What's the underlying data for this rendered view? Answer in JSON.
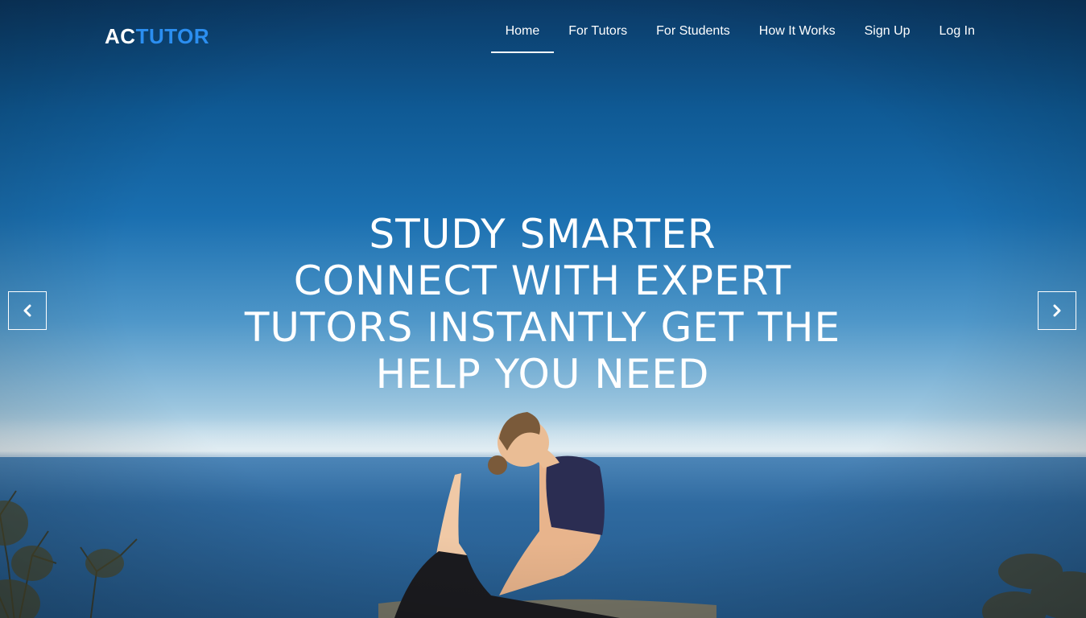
{
  "brand": {
    "logo_part1": "AC",
    "logo_part2": "TUTOR",
    "accent_color": "#2b8ef0"
  },
  "nav": {
    "items": [
      {
        "label": "Home",
        "active": true
      },
      {
        "label": "For Tutors",
        "active": false
      },
      {
        "label": "For Students",
        "active": false
      },
      {
        "label": "How It Works",
        "active": false
      },
      {
        "label": "Sign Up",
        "active": false
      },
      {
        "label": "Log In",
        "active": false
      }
    ]
  },
  "hero": {
    "headline_lines": [
      "STUDY SMARTER",
      "CONNECT WITH EXPERT",
      "TUTORS INSTANTLY GET THE",
      "HELP YOU NEED"
    ],
    "prev_icon": "chevron-left-icon",
    "next_icon": "chevron-right-icon"
  }
}
